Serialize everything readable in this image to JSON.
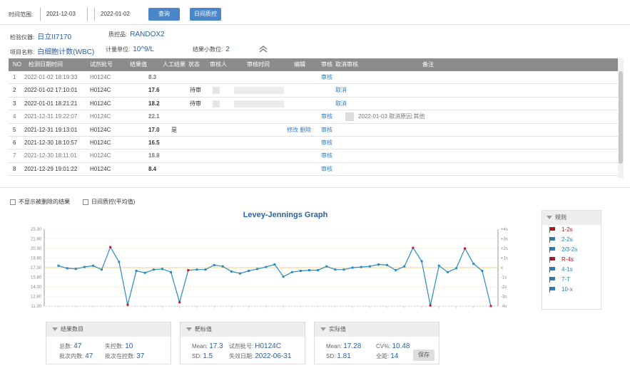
{
  "toolbar": {
    "range_label": "时间范围:",
    "start_date": "2021-12-03",
    "end_date": "2022-01-02",
    "query_label": "查询",
    "daily_button": "日间质控"
  },
  "info": {
    "instrument_label": "检验仪器:",
    "instrument_value": "日立II7170",
    "qc_label": "质控品:",
    "qc_value": "RANDOX2",
    "item_label": "项目名称:",
    "item_value": "白细胞计数(WBC)",
    "unit_label": "计量单位:",
    "unit_value": "10^9/L",
    "decimal_label": "结果小数位:",
    "decimal_value": "2"
  },
  "table": {
    "headers": [
      "NO",
      "检测日期时间",
      "试剂批号",
      "结果值",
      "人工结果",
      "状态",
      "审核人",
      "审核时间",
      "编辑",
      "审核",
      "取消审核",
      "备注"
    ],
    "rows": [
      {
        "no": "1",
        "datetime": "2022-01-02 18:19:33",
        "lot": "H0124C",
        "value": "8.3",
        "manual": "",
        "status": "",
        "reviewer": "",
        "edit": "",
        "audit": "审核",
        "cancel": "",
        "note": "",
        "dim": true
      },
      {
        "no": "2",
        "datetime": "2022-01-02 17:10:01",
        "lot": "H0124C",
        "value": "17.6",
        "manual": "",
        "status": "待审",
        "reviewer": "",
        "edit": "",
        "audit": "",
        "cancel": "取消",
        "note": "",
        "dim": false
      },
      {
        "no": "3",
        "datetime": "2022-01-01 18:21:21",
        "lot": "H0124C",
        "value": "18.2",
        "manual": "",
        "status": "待审",
        "reviewer": "",
        "edit": "",
        "audit": "",
        "cancel": "取消",
        "note": "",
        "dim": false
      },
      {
        "no": "4",
        "datetime": "2021-12-31 19:22:07",
        "lot": "H0124C",
        "value": "22.1",
        "manual": "",
        "status": "",
        "reviewer": "",
        "edit": "",
        "audit": "审核",
        "cancel": "",
        "note": "2022-01-03 取消原因:其他",
        "dim": true
      },
      {
        "no": "5",
        "datetime": "2021-12-31 19:13:01",
        "lot": "H0124C",
        "value": "17.0",
        "manual": "是",
        "status": "",
        "reviewer": "",
        "edit": "修改 删除",
        "audit": "审核",
        "cancel": "",
        "note": "",
        "dim": false
      },
      {
        "no": "6",
        "datetime": "2021-12-30 18:10:57",
        "lot": "H0124C",
        "value": "16.5",
        "manual": "",
        "status": "",
        "reviewer": "",
        "edit": "",
        "audit": "审核",
        "cancel": "",
        "note": "",
        "dim": false
      },
      {
        "no": "7",
        "datetime": "2021-12-30 18:11:01",
        "lot": "H0124C",
        "value": "18.8",
        "manual": "",
        "status": "",
        "reviewer": "",
        "edit": "",
        "audit": "审核",
        "cancel": "",
        "note": "",
        "dim": true
      },
      {
        "no": "8",
        "datetime": "2021-12-29 19:01:22",
        "lot": "H0124C",
        "value": "8.4",
        "manual": "",
        "status": "",
        "reviewer": "",
        "edit": "",
        "audit": "审核",
        "cancel": "",
        "note": "",
        "dim": false
      }
    ]
  },
  "options": {
    "hide_cb": "不显示被删除的结果",
    "daily_cb": "日间质控(平均值)"
  },
  "chart_data": {
    "type": "line",
    "title": "Levey-Jennings Graph",
    "mean": 17.3,
    "sd": 1.5,
    "ylim": [
      11.3,
      23.3
    ],
    "yticks_left": [
      "23.30",
      "21.80",
      "20.30",
      "18.80",
      "17.30",
      "15.80",
      "14.30",
      "12.80",
      "11.30"
    ],
    "yticks_right": [
      "+4s",
      "+3s",
      "+2s",
      "+1s",
      "x",
      "-1s",
      "-2s",
      "-3s",
      "-4s"
    ],
    "values": [
      17.6,
      17.2,
      17.1,
      17.4,
      17.6,
      17.0,
      20.5,
      18.2,
      11.5,
      16.8,
      16.5,
      17.0,
      17.1,
      16.6,
      11.9,
      16.9,
      17.0,
      17.0,
      17.7,
      17.5,
      16.7,
      16.4,
      16.8,
      17.1,
      17.4,
      17.8,
      15.9,
      16.6,
      16.8,
      16.9,
      16.9,
      17.5,
      17.0,
      17.0,
      17.3,
      17.4,
      17.5,
      17.8,
      17.7,
      16.9,
      17.5,
      20.4,
      18.3,
      11.4,
      17.6,
      16.6,
      17.2,
      20.3,
      17.9,
      16.8,
      11.3
    ],
    "outliers": [
      6,
      8,
      14,
      15,
      41,
      43,
      47,
      50
    ]
  },
  "rules": {
    "title": "规则",
    "items": [
      {
        "label": "1-2s",
        "color": "#b5161d"
      },
      {
        "label": "2-2s",
        "color": "#1f82bf"
      },
      {
        "label": "2/3-2s",
        "color": "#1f82bf"
      },
      {
        "label": "R-4s",
        "color": "#b5161d"
      },
      {
        "label": "4-1s",
        "color": "#1f82bf"
      },
      {
        "label": "7-T",
        "color": "#1f82bf"
      },
      {
        "label": "10-x",
        "color": "#1f82bf"
      }
    ]
  },
  "panels": {
    "count_title": "结果数目",
    "total_label": "总数:",
    "total": "47",
    "lost_label": "失控数:",
    "lost": "10",
    "in_batch_label": "批次内数:",
    "in_batch": "47",
    "in_control_label": "批次在控数:",
    "in_control": "37",
    "target_title": "靶标值",
    "mean_label": "Mean:",
    "mean": "17.3",
    "lot_label": "试剂批号:",
    "lot": "H0124C",
    "sd_label": "SD:",
    "sd": "1.5",
    "expire_label": "失效日期:",
    "expire": "2022-06-31",
    "actual_title": "实际值",
    "a_mean_label": "Mean:",
    "a_mean": "17.28",
    "cv_label": "CV%:",
    "cv": "10.48",
    "a_sd_label": "SD:",
    "a_sd": "1.81",
    "range_label": "全距:",
    "range": "14",
    "save": "保存"
  }
}
